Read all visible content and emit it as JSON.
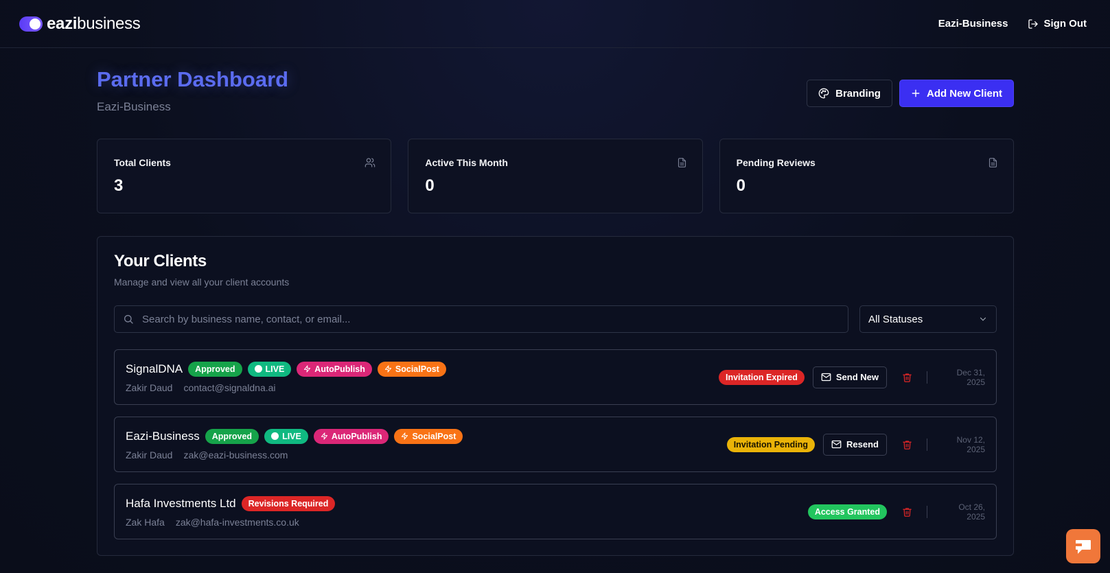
{
  "app": {
    "logo_bold": "eazi",
    "logo_light": "business",
    "org_name": "Eazi-Business",
    "sign_out": "Sign Out"
  },
  "header": {
    "title": "Partner Dashboard",
    "subtitle": "Eazi-Business",
    "branding_label": "Branding",
    "add_client_label": "Add New Client"
  },
  "stats": [
    {
      "label": "Total Clients",
      "value": "3",
      "icon": "users-icon"
    },
    {
      "label": "Active This Month",
      "value": "0",
      "icon": "document-icon"
    },
    {
      "label": "Pending Reviews",
      "value": "0",
      "icon": "document-icon"
    }
  ],
  "clients_panel": {
    "title": "Your Clients",
    "subtitle": "Manage and view all your client accounts",
    "search_placeholder": "Search by business name, contact, or email...",
    "status_filter": "All Statuses"
  },
  "clients": [
    {
      "name": "SignalDNA",
      "badges": [
        "Approved",
        "LIVE",
        "AutoPublish",
        "SocialPost"
      ],
      "contact": "Zakir Daud",
      "email": "contact@signaldna.ai",
      "invite_status": "Invitation Expired",
      "action": "Send New",
      "date": "Dec 31, 2025"
    },
    {
      "name": "Eazi-Business",
      "badges": [
        "Approved",
        "LIVE",
        "AutoPublish",
        "SocialPost"
      ],
      "contact": "Zakir Daud",
      "email": "zak@eazi-business.com",
      "invite_status": "Invitation Pending",
      "action": "Resend",
      "date": "Nov 12, 2025"
    },
    {
      "name": "Hafa Investments Ltd",
      "badges": [
        "Revisions Required"
      ],
      "contact": "Zak Hafa",
      "email": "zak@hafa-investments.co.uk",
      "invite_status": "Access Granted",
      "date": "Oct 26, 2025"
    }
  ],
  "colors": {
    "accent": "#3b2ff2",
    "title": "#5b6cf0",
    "approved": "#16a34a",
    "live": "#10b981",
    "autopublish": "#db2777",
    "socialpost": "#f97316",
    "expired": "#dc2626",
    "pending": "#eab308",
    "granted": "#22c55e",
    "chat": "#f0773a"
  }
}
